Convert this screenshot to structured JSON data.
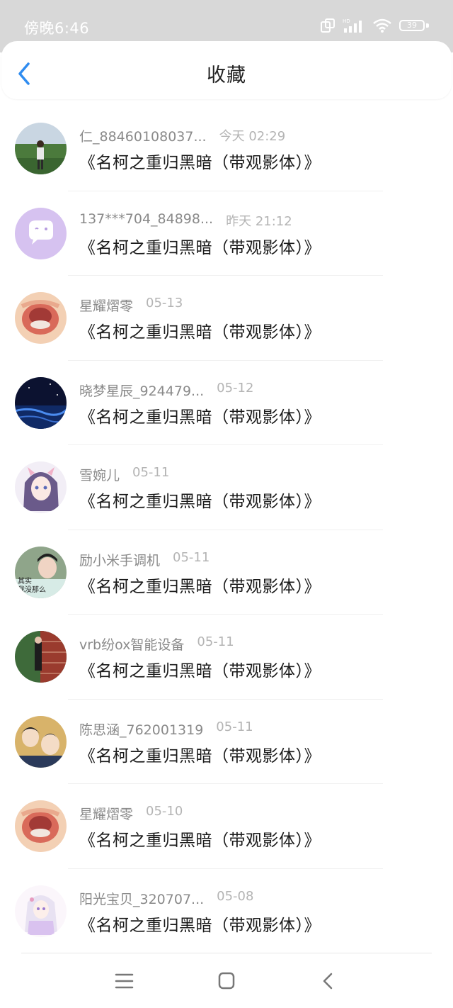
{
  "status": {
    "time": "傍晚6:46",
    "battery": "39",
    "network": "HD"
  },
  "header": {
    "title": "收藏"
  },
  "items": [
    {
      "user": "仁_88460108037...",
      "time": "今天 02:29",
      "title": "《名柯之重归黑暗（带观影体）》",
      "avatar": "person-field"
    },
    {
      "user": "137***704_84898...",
      "time": "昨天 21:12",
      "title": "《名柯之重归黑暗（带观影体）》",
      "avatar": "chat-bubble"
    },
    {
      "user": "星耀熠零",
      "time": "05-13",
      "title": "《名柯之重归黑暗（带观影体）》",
      "avatar": "mouth"
    },
    {
      "user": "晓梦星辰_924479...",
      "time": "05-12",
      "title": "《名柯之重归黑暗（带观影体）》",
      "avatar": "night-sea"
    },
    {
      "user": "雪婉儿",
      "time": "05-11",
      "title": "《名柯之重归黑暗（带观影体）》",
      "avatar": "anime-girl"
    },
    {
      "user": "励小米手调机",
      "time": "05-11",
      "title": "《名柯之重归黑暗（带观影体）》",
      "avatar": "boy-text",
      "avatar_text": "其实 我没那么"
    },
    {
      "user": "vrb纷ox智能设备",
      "time": "05-11",
      "title": "《名柯之重归黑暗（带观影体）》",
      "avatar": "brick-wall"
    },
    {
      "user": "陈思涵_762001319",
      "time": "05-11",
      "title": "《名柯之重归黑暗（带观影体）》",
      "avatar": "anime-boys"
    },
    {
      "user": "星耀熠零",
      "time": "05-10",
      "title": "《名柯之重归黑暗（带观影体）》",
      "avatar": "mouth"
    },
    {
      "user": "阳光宝贝_320707...",
      "time": "05-08",
      "title": "《名柯之重归黑暗（带观影体）》",
      "avatar": "anime-white-hair"
    }
  ],
  "colors": {
    "accent": "#2f8cf0",
    "status_bar": "#d8d8d8",
    "username": "#8a8a8a",
    "time": "#b4b4b4"
  },
  "navbar": {
    "icons": [
      "menu-icon",
      "home-icon",
      "back-icon"
    ]
  }
}
